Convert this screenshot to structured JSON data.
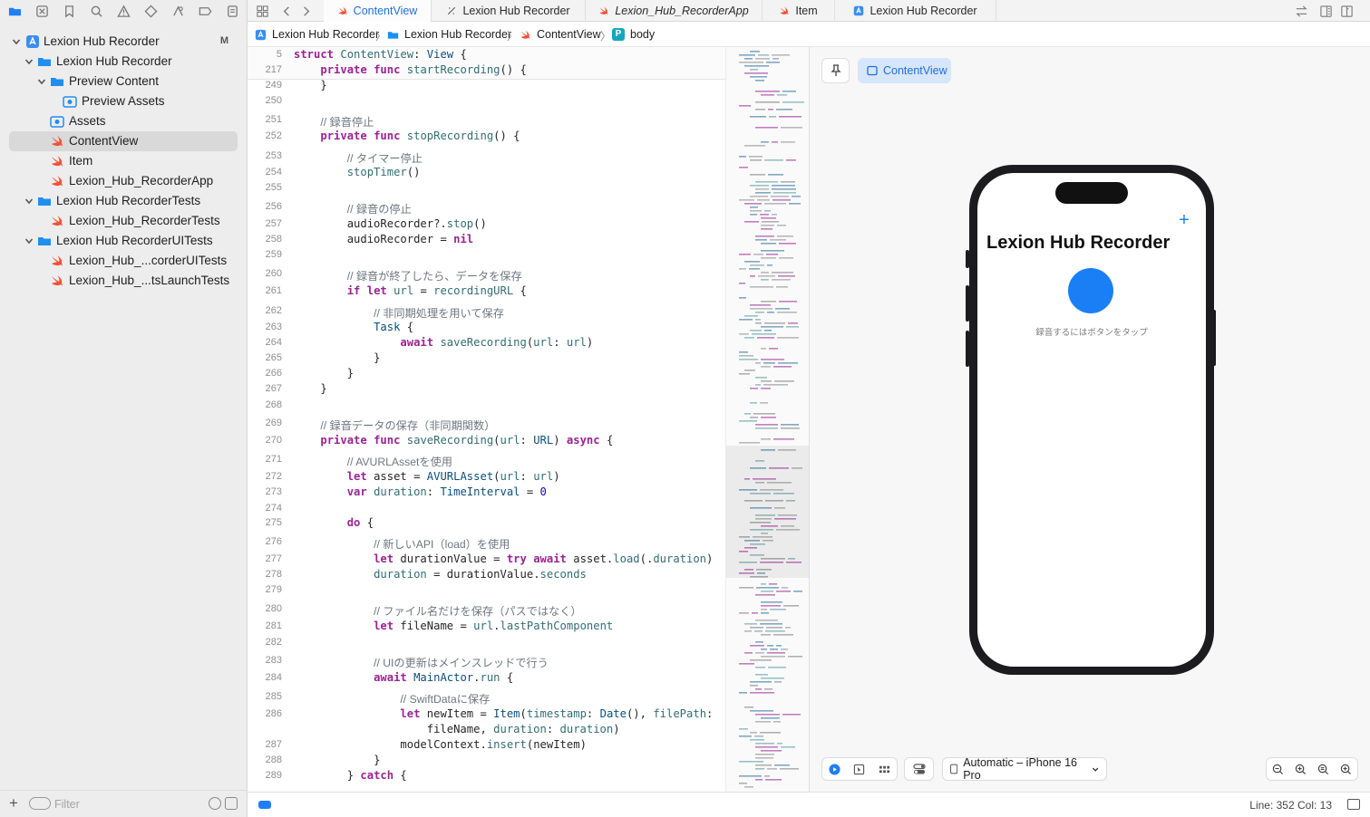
{
  "sidebar": {
    "filter_placeholder": "Filter",
    "tree": [
      {
        "label": "Lexion Hub Recorder",
        "badge": "M"
      },
      {
        "label": "Lexion Hub Recorder"
      },
      {
        "label": "Preview Content"
      },
      {
        "label": "Preview Assets"
      },
      {
        "label": "Assets"
      },
      {
        "label": "ContentView"
      },
      {
        "label": "Item"
      },
      {
        "label": "Lexion_Hub_RecorderApp"
      },
      {
        "label": "Lexion Hub RecorderTests"
      },
      {
        "label": "Lexion_Hub_RecorderTests"
      },
      {
        "label": "Lexion Hub RecorderUITests"
      },
      {
        "label": "Lexion_Hub_...corderUITests"
      },
      {
        "label": "Lexion_Hub_...tsLaunchTests"
      }
    ]
  },
  "tabs": [
    "ContentView",
    "Lexion Hub Recorder",
    "Lexion_Hub_RecorderApp",
    "Item",
    "Lexion Hub Recorder"
  ],
  "breadcrumb": [
    "Lexion Hub Recorder",
    "Lexion Hub Recorder",
    "ContentView",
    "body"
  ],
  "code": [
    {
      "n": "5",
      "t": "struct ContentView: View {"
    },
    {
      "n": "217",
      "t": "    private func startRecording() {"
    },
    {
      "n": "249",
      "t": "    }"
    },
    {
      "n": "250",
      "t": ""
    },
    {
      "n": "251",
      "t": "    // 録音停止"
    },
    {
      "n": "252",
      "t": "    private func stopRecording() {"
    },
    {
      "n": "253",
      "t": "        // タイマー停止"
    },
    {
      "n": "254",
      "t": "        stopTimer()"
    },
    {
      "n": "255",
      "t": ""
    },
    {
      "n": "256",
      "t": "        // 録音の停止"
    },
    {
      "n": "257",
      "t": "        audioRecorder?.stop()"
    },
    {
      "n": "258",
      "t": "        audioRecorder = nil"
    },
    {
      "n": "259",
      "t": ""
    },
    {
      "n": "260",
      "t": "        // 録音が終了したら、データを保存"
    },
    {
      "n": "261",
      "t": "        if let url = recordingURL {"
    },
    {
      "n": "262",
      "t": "            // 非同期処理を用いて保存"
    },
    {
      "n": "263",
      "t": "            Task {"
    },
    {
      "n": "264",
      "t": "                await saveRecording(url: url)"
    },
    {
      "n": "265",
      "t": "            }"
    },
    {
      "n": "266",
      "t": "        }"
    },
    {
      "n": "267",
      "t": "    }"
    },
    {
      "n": "268",
      "t": ""
    },
    {
      "n": "269",
      "t": "    // 録音データの保存（非同期関数）"
    },
    {
      "n": "270",
      "t": "    private func saveRecording(url: URL) async {"
    },
    {
      "n": "271",
      "t": "        // AVURLAssetを使用"
    },
    {
      "n": "272",
      "t": "        let asset = AVURLAsset(url: url)"
    },
    {
      "n": "273",
      "t": "        var duration: TimeInterval = 0"
    },
    {
      "n": "274",
      "t": ""
    },
    {
      "n": "275",
      "t": "        do {"
    },
    {
      "n": "276",
      "t": "            // 新しいAPI（load）を使用"
    },
    {
      "n": "277",
      "t": "            let durationValue = try await asset.load(.duration)"
    },
    {
      "n": "278",
      "t": "            duration = durationValue.seconds"
    },
    {
      "n": "279",
      "t": ""
    },
    {
      "n": "280",
      "t": "            // ファイル名だけを保存（パスではなく）"
    },
    {
      "n": "281",
      "t": "            let fileName = url.lastPathComponent"
    },
    {
      "n": "282",
      "t": ""
    },
    {
      "n": "283",
      "t": "            // UIの更新はメインスレッドで行う"
    },
    {
      "n": "284",
      "t": "            await MainActor.run {"
    },
    {
      "n": "285",
      "t": "                // SwiftDataに保存"
    },
    {
      "n": "286",
      "t": "                let newItem = Item(timestamp: Date(), filePath:"
    },
    {
      "n": "",
      "t": "                    fileName, duration: duration)"
    },
    {
      "n": "287",
      "t": "                modelContext.insert(newItem)"
    },
    {
      "n": "288",
      "t": "            }"
    },
    {
      "n": "289",
      "t": "        } catch {"
    }
  ],
  "canvas": {
    "chip_label": "ContentView",
    "app_title": "Lexion Hub Recorder",
    "hint": "録音するにはボタンをタップ",
    "device_picker": "Automatic – iPhone 16 Pro"
  },
  "status": {
    "position": "Line: 352  Col: 13"
  },
  "colors": {
    "accent": "#1f7ef5",
    "keyword": "#9b2393",
    "swift_orange": "#f05138",
    "folder_blue": "#1f8ef1"
  }
}
